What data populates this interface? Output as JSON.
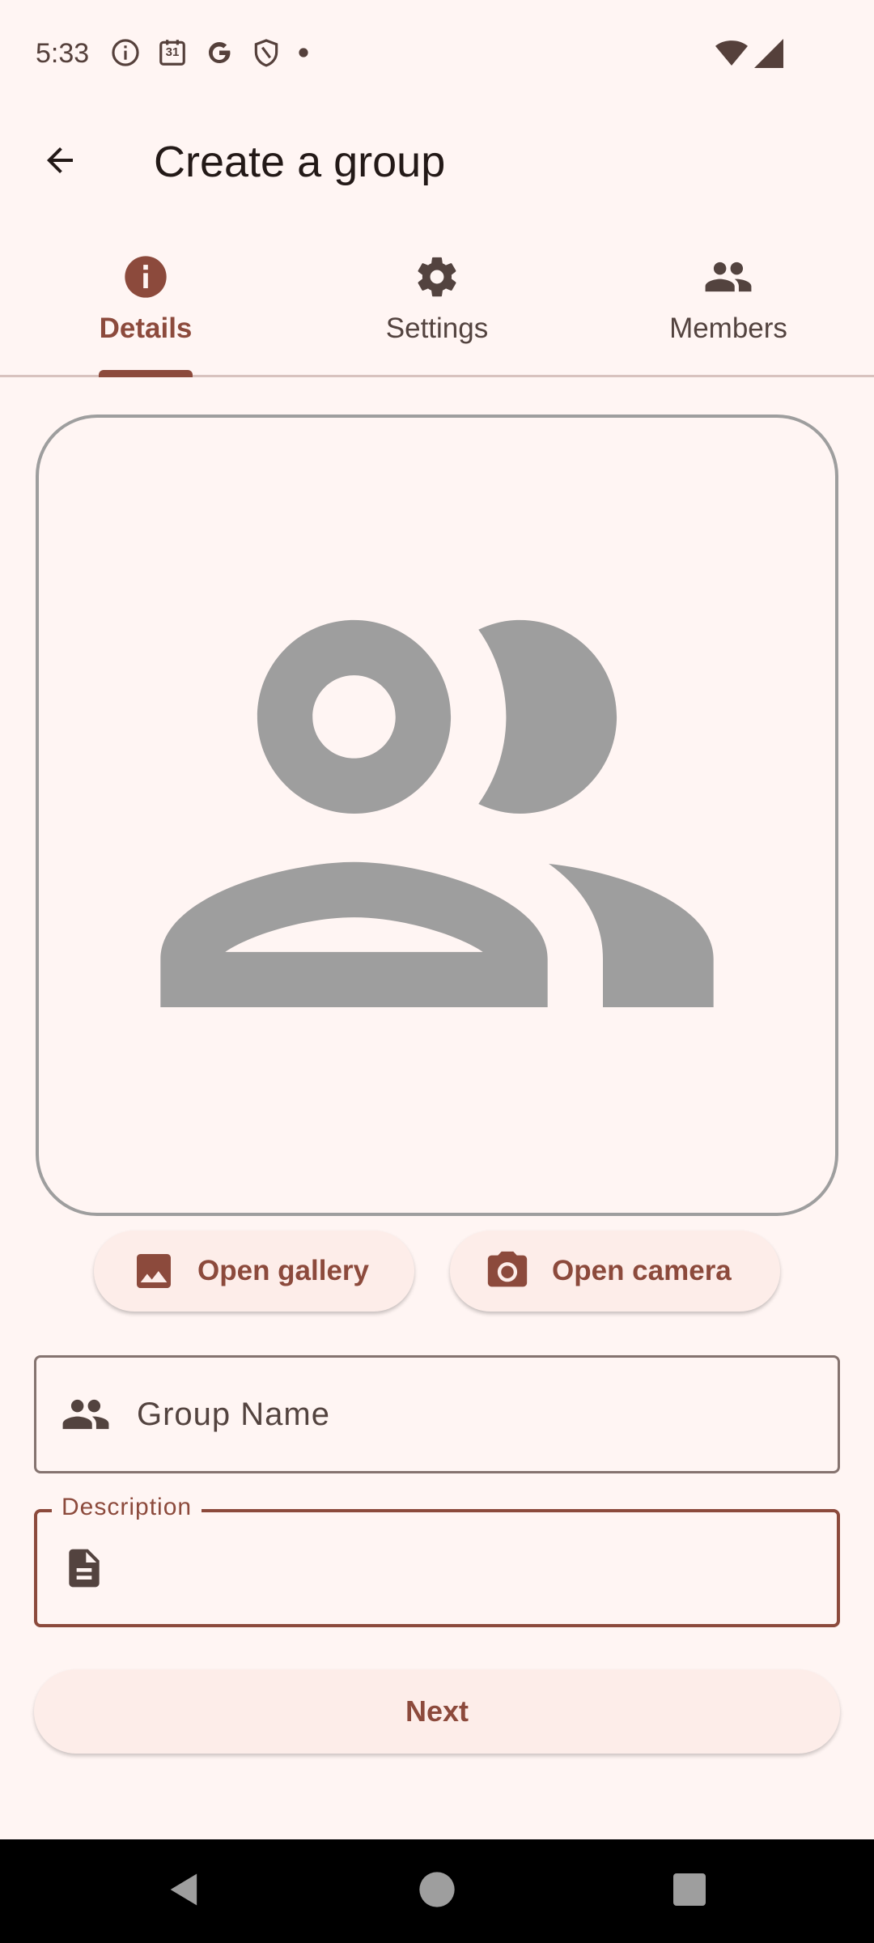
{
  "status_bar": {
    "time": "5:33",
    "icons": [
      "info-icon",
      "calendar-icon",
      "google-icon",
      "shield-icon",
      "dot-icon"
    ],
    "calendar_day": "31",
    "right_icons": [
      "wifi-icon",
      "signal-icon"
    ]
  },
  "app_bar": {
    "back_icon": "arrow-back-icon",
    "title": "Create a group"
  },
  "tabs": [
    {
      "label": "Details",
      "icon": "info-icon",
      "active": true
    },
    {
      "label": "Settings",
      "icon": "gear-icon",
      "active": false
    },
    {
      "label": "Members",
      "icon": "group-icon",
      "active": false
    }
  ],
  "avatar": {
    "icon": "group-placeholder-icon"
  },
  "actions": {
    "gallery_label": "Open gallery",
    "camera_label": "Open camera"
  },
  "form": {
    "group_name_placeholder": "Group Name",
    "group_name_value": "",
    "description_label": "Description",
    "description_value": ""
  },
  "next_label": "Next",
  "colors": {
    "background": "#fff5f3",
    "accent": "#8c4a3c",
    "icon_dark": "#53433f",
    "placeholder_gray": "#9e9e9e"
  },
  "nav": [
    "back-nav-icon",
    "home-nav-icon",
    "recents-nav-icon"
  ]
}
